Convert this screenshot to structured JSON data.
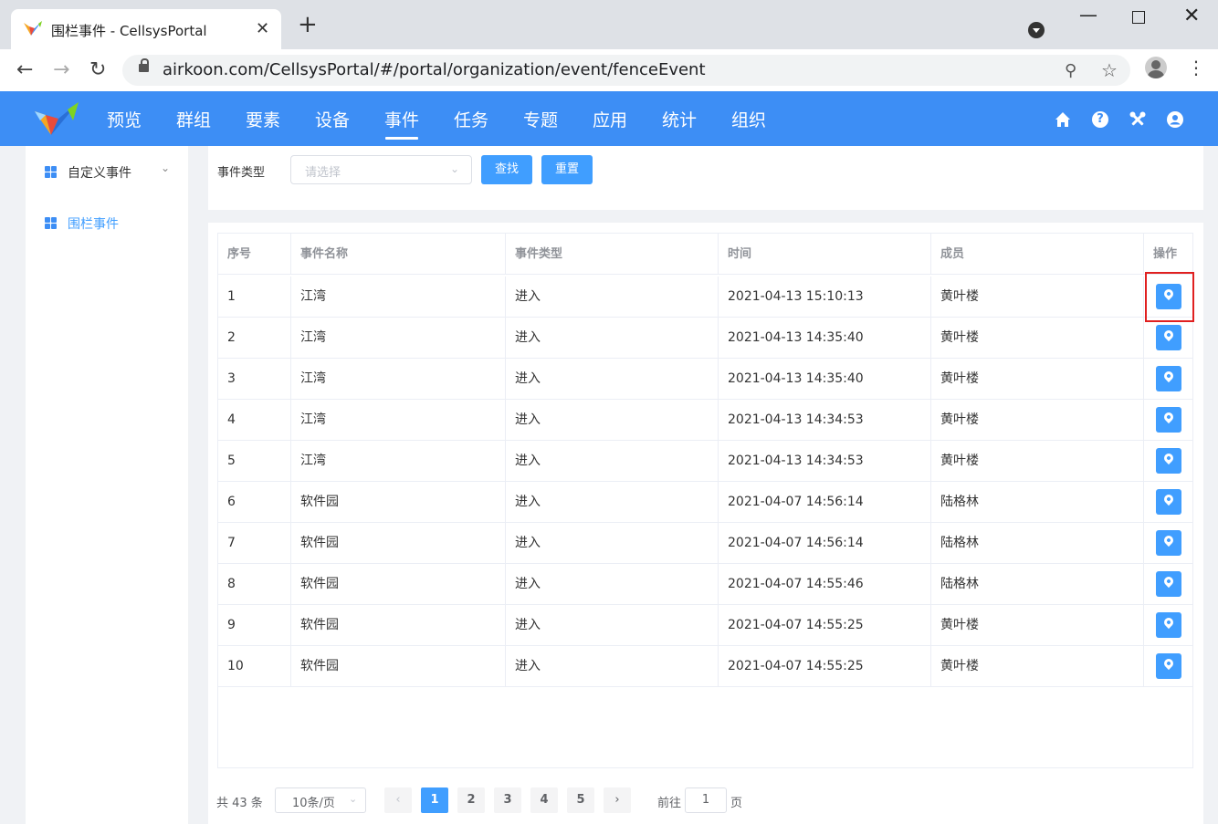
{
  "browser": {
    "tab_title": "围栏事件 - CellsysPortal",
    "url": "airkoon.com/CellsysPortal/#/portal/organization/event/fenceEvent"
  },
  "nav": {
    "items": [
      "预览",
      "群组",
      "要素",
      "设备",
      "事件",
      "任务",
      "专题",
      "应用",
      "统计",
      "组织"
    ],
    "active": "事件"
  },
  "sidebar": {
    "items": [
      {
        "label": "自定义事件",
        "active": false
      },
      {
        "label": "围栏事件",
        "active": true
      }
    ]
  },
  "search": {
    "label": "事件类型",
    "placeholder": "请选择",
    "search_btn": "查找",
    "reset_btn": "重置"
  },
  "table": {
    "headers": [
      "序号",
      "事件名称",
      "事件类型",
      "时间",
      "成员",
      "操作"
    ],
    "rows": [
      [
        "1",
        "江湾",
        "进入",
        "2021-04-13 15:10:13",
        "黄叶楼"
      ],
      [
        "2",
        "江湾",
        "进入",
        "2021-04-13 14:35:40",
        "黄叶楼"
      ],
      [
        "3",
        "江湾",
        "进入",
        "2021-04-13 14:35:40",
        "黄叶楼"
      ],
      [
        "4",
        "江湾",
        "进入",
        "2021-04-13 14:34:53",
        "黄叶楼"
      ],
      [
        "5",
        "江湾",
        "进入",
        "2021-04-13 14:34:53",
        "黄叶楼"
      ],
      [
        "6",
        "软件园",
        "进入",
        "2021-04-07 14:56:14",
        "陆格林"
      ],
      [
        "7",
        "软件园",
        "进入",
        "2021-04-07 14:56:14",
        "陆格林"
      ],
      [
        "8",
        "软件园",
        "进入",
        "2021-04-07 14:55:46",
        "陆格林"
      ],
      [
        "9",
        "软件园",
        "进入",
        "2021-04-07 14:55:25",
        "黄叶楼"
      ],
      [
        "10",
        "软件园",
        "进入",
        "2021-04-07 14:55:25",
        "黄叶楼"
      ]
    ]
  },
  "pagination": {
    "total": "共 43 条",
    "page_size": "10条/页",
    "pages": [
      "1",
      "2",
      "3",
      "4",
      "5"
    ],
    "current": "1",
    "goto_prefix": "前往",
    "goto_value": "1",
    "goto_suffix": "页"
  },
  "colors": {
    "header_bg": "#3d8ef5",
    "primary": "#409eff",
    "highlight_box": "#e02020"
  }
}
